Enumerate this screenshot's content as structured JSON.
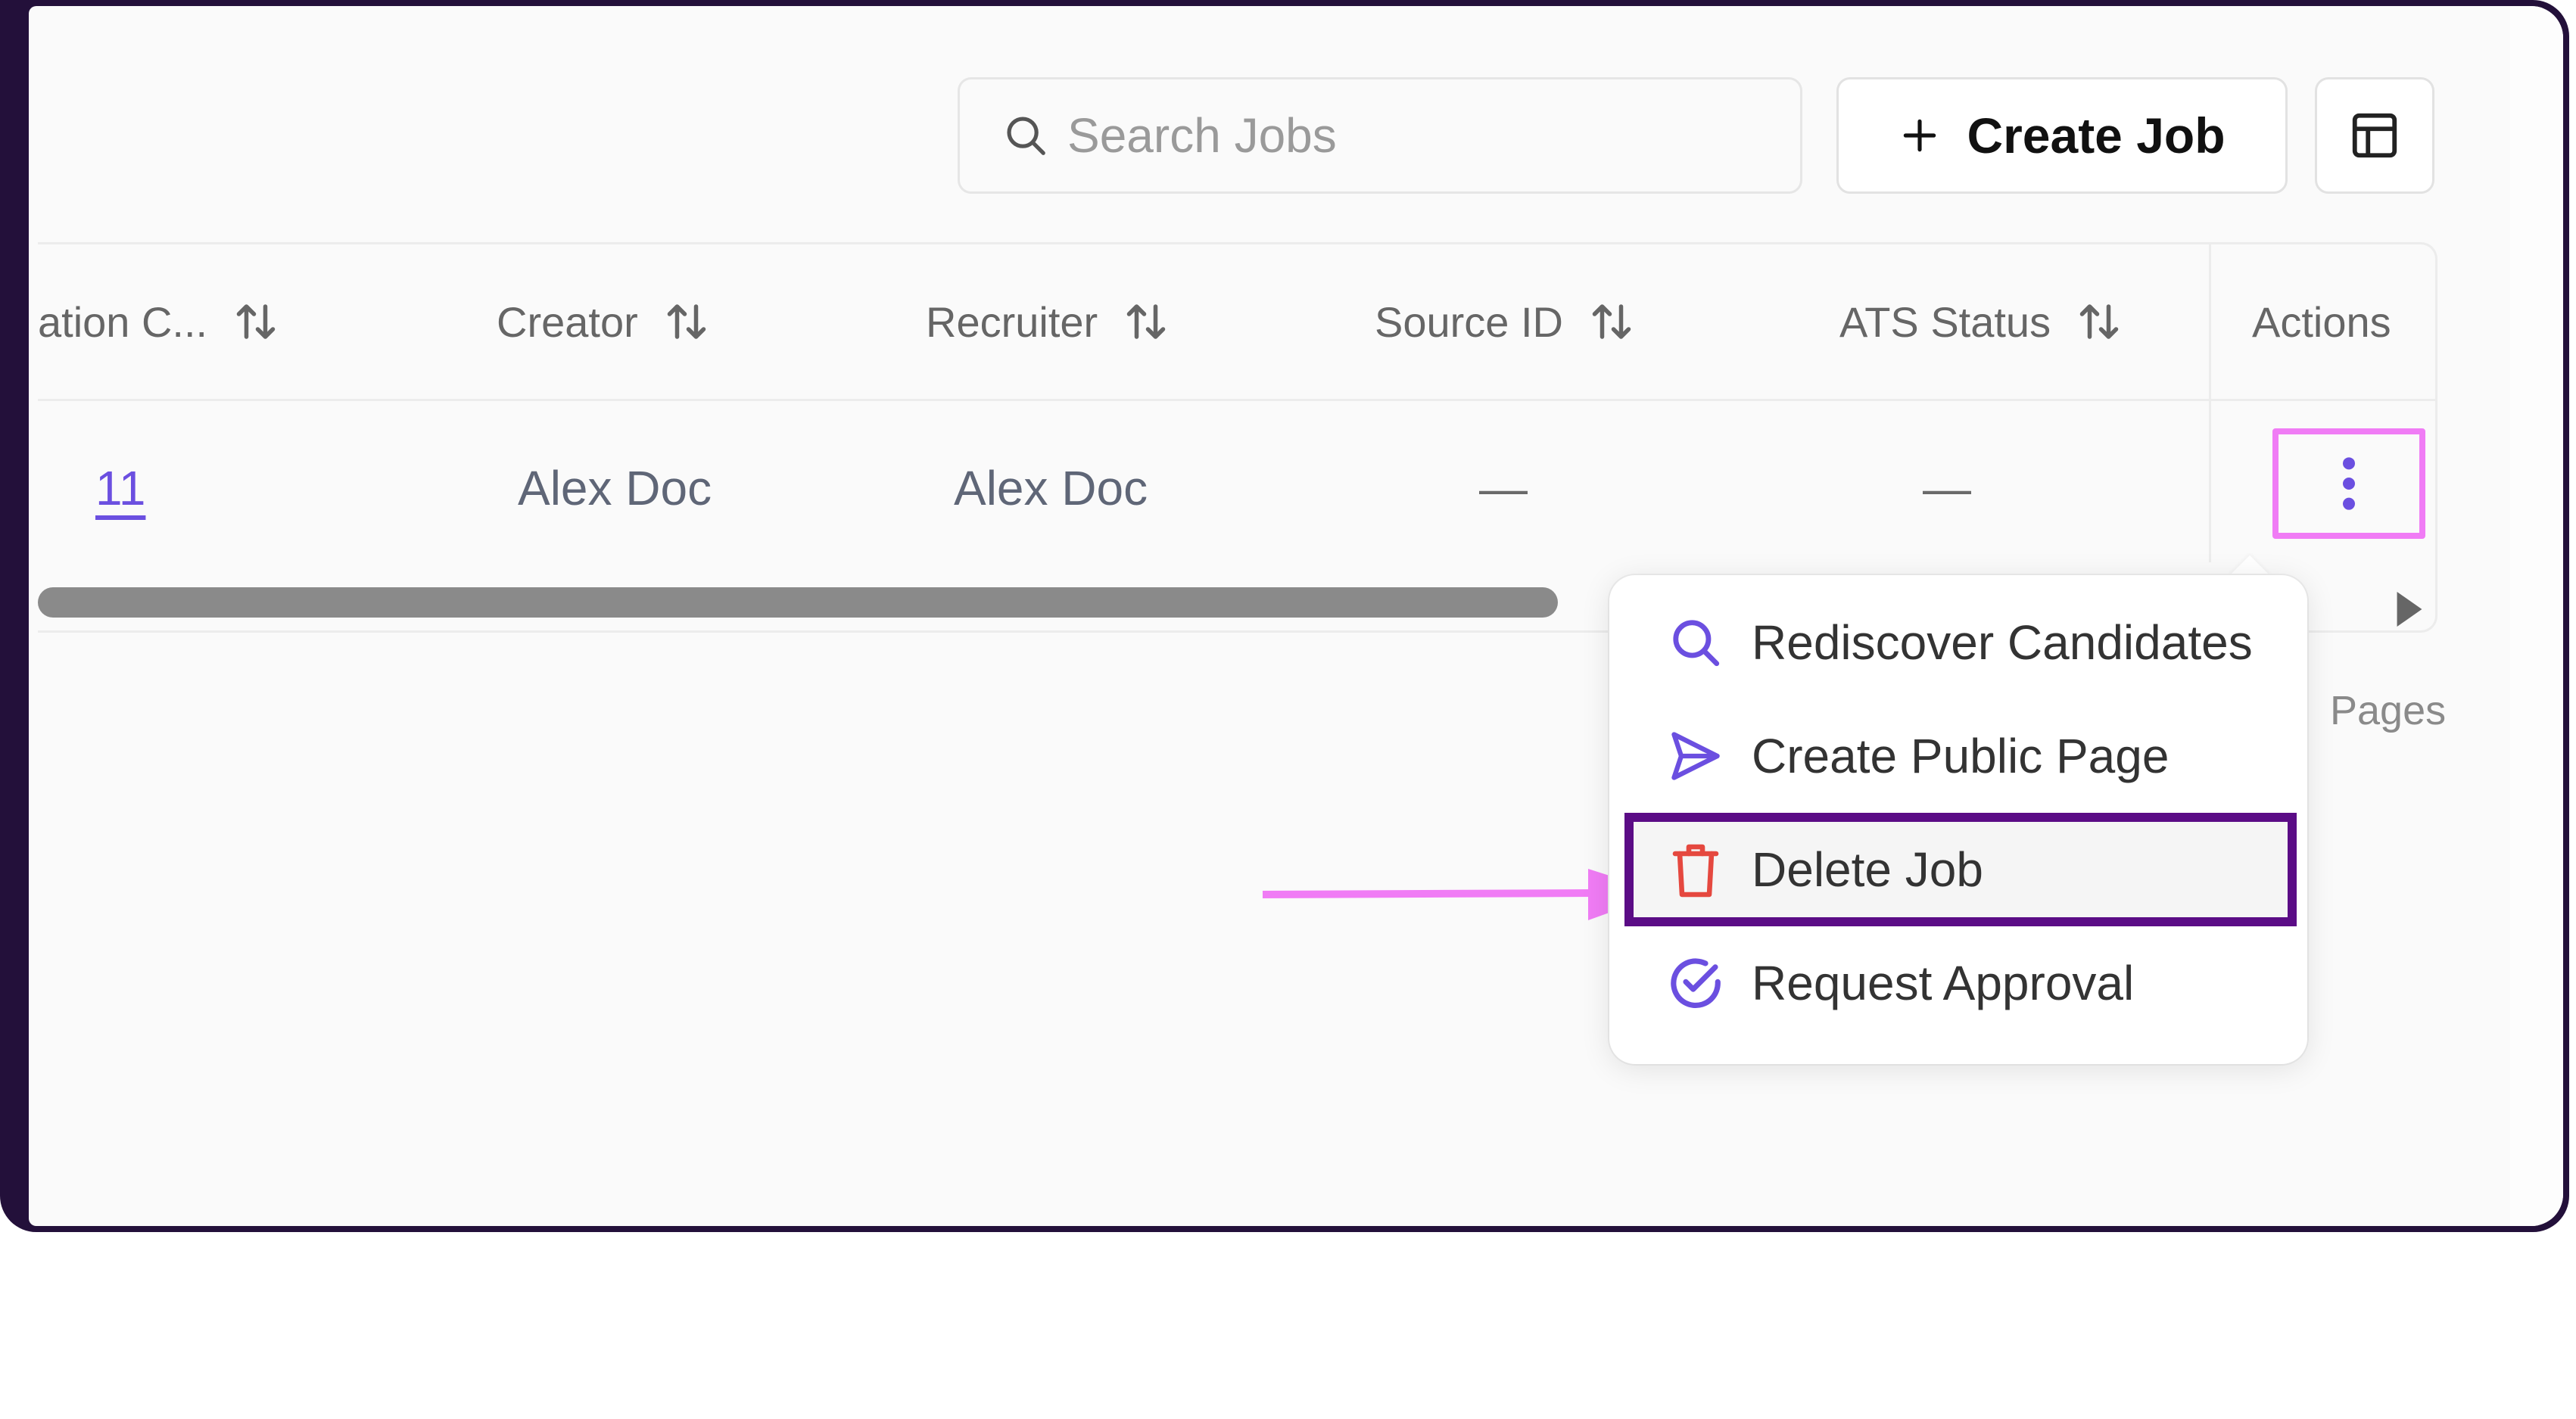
{
  "toolbar": {
    "search_placeholder": "Search Jobs",
    "create_job_label": "Create Job"
  },
  "table": {
    "columns": [
      {
        "label": "ation C..."
      },
      {
        "label": "Creator"
      },
      {
        "label": "Recruiter"
      },
      {
        "label": "Source ID"
      },
      {
        "label": "ATS Status"
      }
    ],
    "actions_label": "Actions",
    "row": {
      "count_link": "11",
      "creator": "Alex Doc",
      "recruiter": "Alex Doc",
      "source_id": "—",
      "ats_status": "—"
    },
    "pages_partial": "Pages"
  },
  "menu": {
    "items": [
      {
        "label": "Rediscover Candidates",
        "icon": "search-icon"
      },
      {
        "label": "Create Public Page",
        "icon": "send-icon"
      },
      {
        "label": "Delete Job",
        "icon": "trash-icon"
      },
      {
        "label": "Request Approval",
        "icon": "check-circle-icon"
      }
    ]
  },
  "colors": {
    "accent": "#6b4fe0",
    "delete": "#e5483f",
    "highlight_box": "#f07cf5",
    "selected_border": "#5b0c86",
    "annotation_arrow": "#f07cf5"
  }
}
